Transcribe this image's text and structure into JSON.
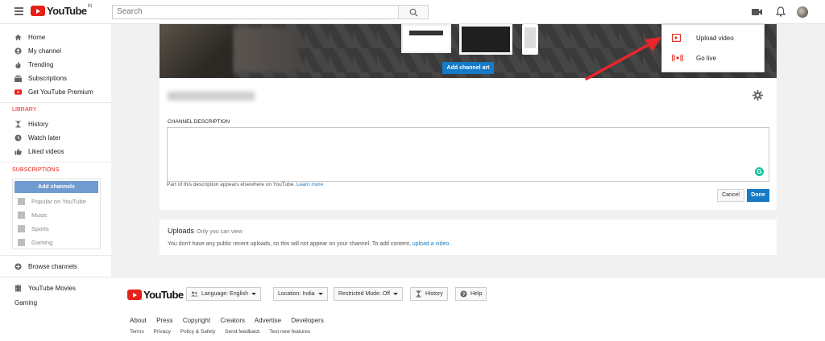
{
  "masthead": {
    "logo_text": "YouTube",
    "country_code": "IN",
    "search_placeholder": "Search"
  },
  "sidebar": {
    "items": [
      {
        "label": "Home",
        "icon": "home-icon"
      },
      {
        "label": "My channel",
        "icon": "person-icon"
      },
      {
        "label": "Trending",
        "icon": "flame-icon"
      },
      {
        "label": "Subscriptions",
        "icon": "subscriptions-icon"
      },
      {
        "label": "Get YouTube Premium",
        "icon": "youtube-premium-icon"
      }
    ],
    "library_heading": "LIBRARY",
    "library_items": [
      {
        "label": "History",
        "icon": "hourglass-icon"
      },
      {
        "label": "Watch later",
        "icon": "clock-icon"
      },
      {
        "label": "Liked videos",
        "icon": "thumbs-up-icon"
      }
    ],
    "subscriptions_heading": "SUBSCRIPTIONS",
    "add_channels_label": "Add channels",
    "suggestions": [
      {
        "label": "Popular on YouTube"
      },
      {
        "label": "Music"
      },
      {
        "label": "Sports"
      },
      {
        "label": "Gaming"
      }
    ],
    "browse_channels": "Browse channels",
    "youtube_movies": "YouTube Movies",
    "gaming": "Gaming"
  },
  "channel": {
    "add_channel_art": "Add channel art",
    "description_label": "CHANNEL DESCRIPTION",
    "description_note": "Part of this description appears elsewhere on YouTube.",
    "learn_more": "Learn more",
    "cancel": "Cancel",
    "done": "Done",
    "grammarly_badge": "G"
  },
  "uploads": {
    "title": "Uploads",
    "subtitle": "Only you can view",
    "text": "You don't have any public recent uploads, so this will not appear on your channel. To add content,",
    "link": "upload a video."
  },
  "upload_menu": {
    "upload_video": "Upload video",
    "go_live": "Go live"
  },
  "footer": {
    "logo_text": "YouTube",
    "language": "Language: English",
    "location": "Location: India",
    "restricted": "Restricted Mode: Off",
    "history": "History",
    "help": "Help",
    "links": [
      "About",
      "Press",
      "Copyright",
      "Creators",
      "Advertise",
      "Developers"
    ],
    "links2": [
      "Terms",
      "Privacy",
      "Policy & Safety",
      "Send feedback",
      "Test new features"
    ]
  },
  "colors": {
    "brand_red": "#e62117",
    "link_blue": "#167ac6",
    "annotation_arrow": "#e8262b"
  }
}
